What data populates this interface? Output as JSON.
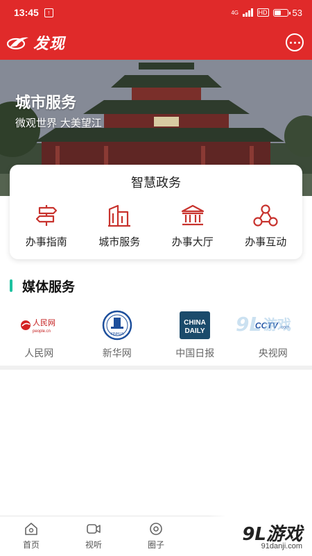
{
  "status_bar": {
    "time": "13:45",
    "network": "4G",
    "battery": "53",
    "battery_level": 0.53
  },
  "header": {
    "title": "发现",
    "logo_icon": "red-swoosh-logo",
    "message_icon": "chat-bubble-icon"
  },
  "banner": {
    "title": "城市服务",
    "subtitle": "微观世界  大美望江"
  },
  "gov_card": {
    "title": "智慧政务",
    "items": [
      {
        "label": "办事指南",
        "icon": "signpost-icon"
      },
      {
        "label": "城市服务",
        "icon": "city-buildings-icon"
      },
      {
        "label": "办事大厅",
        "icon": "hall-building-icon"
      },
      {
        "label": "办事互动",
        "icon": "interaction-nodes-icon"
      }
    ]
  },
  "media": {
    "title": "媒体服务",
    "items": [
      {
        "label": "人民网",
        "logo_text": "人民网",
        "logo_sub": "people.cn"
      },
      {
        "label": "新华网",
        "logo_text": "XINHUA"
      },
      {
        "label": "中国日报",
        "logo_text": "CHINA",
        "logo_text2": "DAILY"
      },
      {
        "label": "央视网",
        "logo_text": "CCTV",
        "logo_sub": ".com"
      }
    ]
  },
  "tab_bar": {
    "tabs": [
      {
        "label": "首页",
        "icon": "home-icon"
      },
      {
        "label": "视听",
        "icon": "video-camera-icon"
      },
      {
        "label": "圈子",
        "icon": "circle-icon"
      }
    ]
  },
  "watermark": {
    "brand": "9L游戏",
    "url": "91danji.com"
  },
  "colors": {
    "primary": "#e02a2a",
    "accent": "#1ec2a0",
    "icon_red": "#c8332e"
  }
}
